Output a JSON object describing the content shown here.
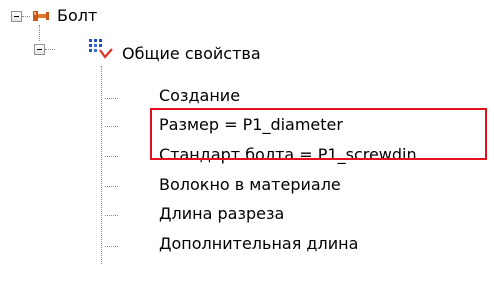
{
  "tree": {
    "root": {
      "label": "Болт",
      "icon": "bolt-node-icon",
      "expanded": true
    },
    "group": {
      "label": "Общие свойства",
      "icon": "general-properties-icon",
      "expanded": true
    },
    "items": [
      {
        "label": "Создание"
      },
      {
        "label": "Размер = P1_diameter",
        "highlighted": true
      },
      {
        "label": "Стандарт болта = P1_screwdin",
        "highlighted": true
      },
      {
        "label": "Волокно в материале"
      },
      {
        "label": "Длина разреза"
      },
      {
        "label": "Дополнительная длина"
      }
    ]
  },
  "colors": {
    "highlight_border": "#e3101e",
    "tree_lines": "#8a8a8a",
    "bolt_icon": "#c8571a",
    "group_icon_dots": "#1f4fb8",
    "group_icon_check": "#d9342b"
  }
}
